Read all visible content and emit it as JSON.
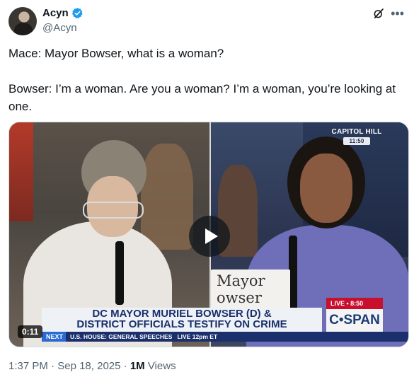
{
  "author": {
    "display_name": "Acyn",
    "handle": "@Acyn",
    "verified": true
  },
  "icons": {
    "verified": "verified-badge-icon",
    "grok": "grok-icon",
    "more": "more-dots-icon",
    "play": "play-icon"
  },
  "colors": {
    "verified_blue": "#1d9bf0",
    "text_primary": "#0f1419",
    "text_secondary": "#536471",
    "cspan_red": "#c8102e",
    "cspan_navy": "#1a2f6b"
  },
  "tweet": {
    "text": "Mace: Mayor Bowser, what is a woman?\n\nBowser: I’m a woman. Are you a woman? I’m a woman, you’re looking at one."
  },
  "video": {
    "duration": "0:11",
    "overlay": {
      "nameplate": "Mayor\nowser",
      "location": "CAPITOL HILL",
      "location_time": "11:50",
      "live_label": "LIVE • 8:50",
      "network": "C•SPAN",
      "headline": "DC MAYOR MURIEL BOWSER (D) &\nDISTRICT OFFICIALS TESTIFY ON CRIME",
      "ticker_prefix": "NEXT",
      "ticker_text": "U.S. HOUSE: GENERAL SPEECHES   LIVE 12pm ET"
    }
  },
  "meta": {
    "time": "1:37 PM",
    "separator": "·",
    "date": "Sep 18, 2025",
    "views_count": "1M",
    "views_label": "Views"
  }
}
